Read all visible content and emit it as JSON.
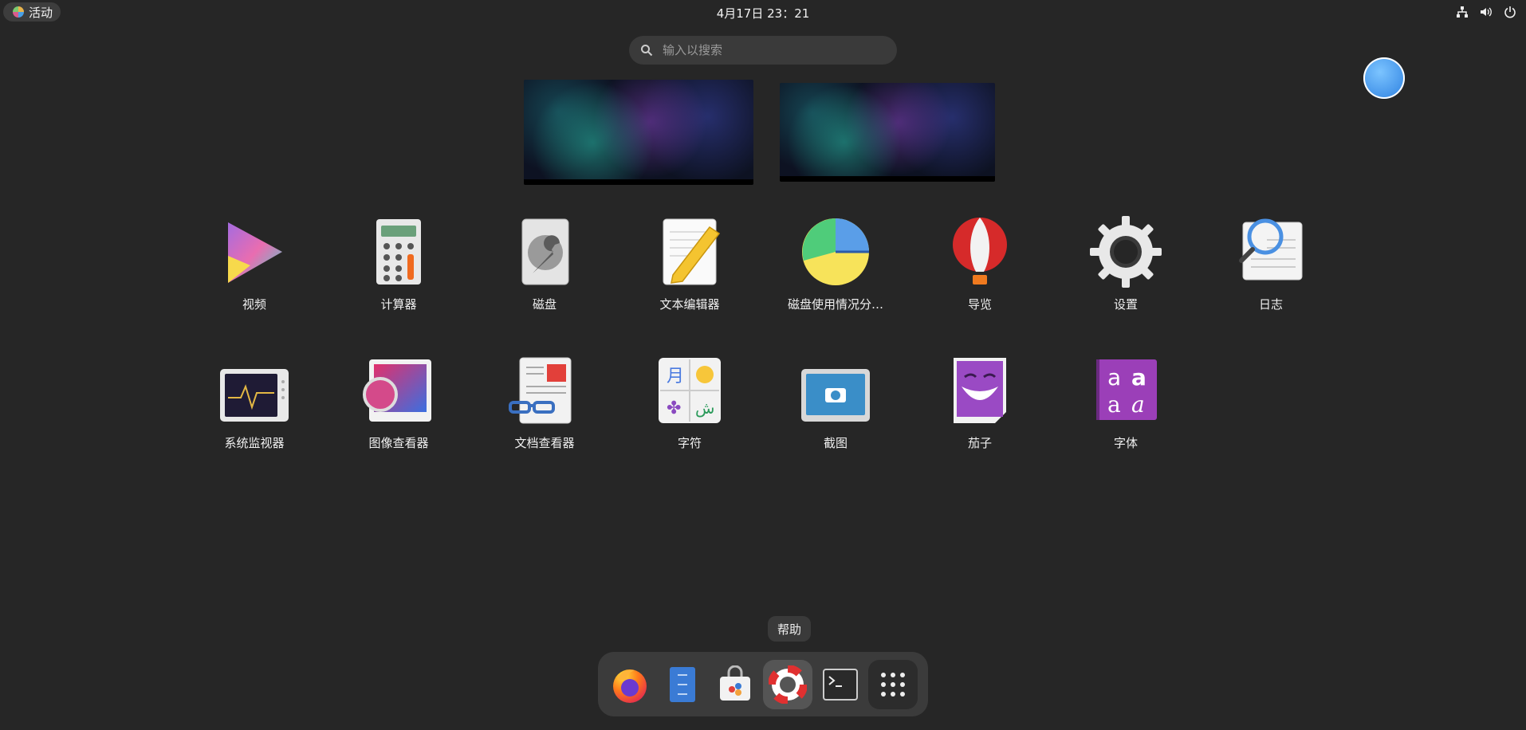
{
  "topbar": {
    "activities_label": "活动",
    "clock": "4月17日  23：21",
    "tray_icons": [
      "network-icon",
      "volume-icon",
      "power-icon"
    ]
  },
  "search": {
    "placeholder": "输入以搜索"
  },
  "apps": [
    {
      "label": "视频",
      "icon": "video-player-icon"
    },
    {
      "label": "计算器",
      "icon": "calculator-icon"
    },
    {
      "label": "磁盘",
      "icon": "disks-icon"
    },
    {
      "label": "文本编辑器",
      "icon": "text-editor-icon"
    },
    {
      "label": "磁盘使用情况分…",
      "icon": "disk-usage-icon"
    },
    {
      "label": "导览",
      "icon": "tour-balloon-icon"
    },
    {
      "label": "设置",
      "icon": "settings-gear-icon"
    },
    {
      "label": "日志",
      "icon": "logs-icon"
    },
    {
      "label": "系统监视器",
      "icon": "system-monitor-icon"
    },
    {
      "label": "图像查看器",
      "icon": "image-viewer-icon"
    },
    {
      "label": "文档查看器",
      "icon": "document-viewer-icon"
    },
    {
      "label": "字符",
      "icon": "characters-icon"
    },
    {
      "label": "截图",
      "icon": "screenshot-icon"
    },
    {
      "label": "茄子",
      "icon": "cheese-icon"
    },
    {
      "label": "字体",
      "icon": "fonts-icon"
    }
  ],
  "dock": {
    "tooltip": "帮助",
    "items": [
      "firefox-icon",
      "files-icon",
      "software-store-icon",
      "help-icon",
      "terminal-icon",
      "show-apps-icon"
    ]
  }
}
